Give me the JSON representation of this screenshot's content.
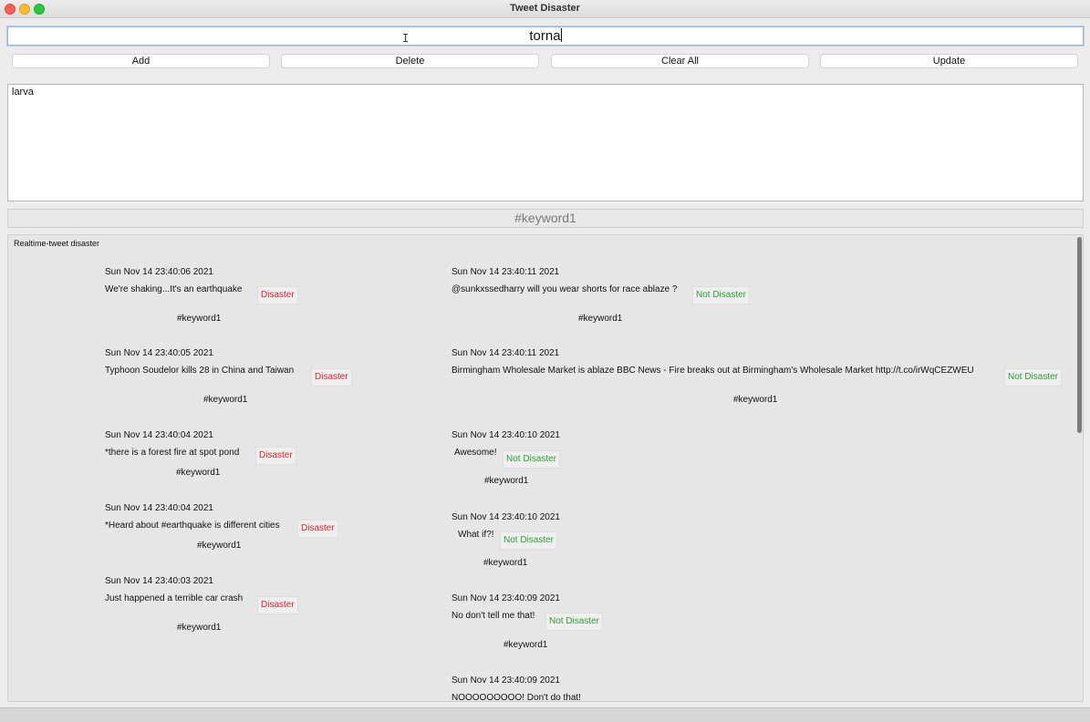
{
  "window": {
    "title": "Tweet Disaster"
  },
  "entry": {
    "value": "torna"
  },
  "buttons": {
    "add": "Add",
    "delete": "Delete",
    "clear_all": "Clear All",
    "update": "Update"
  },
  "keyword_list": [
    "larva"
  ],
  "current_keyword": "#keyword1",
  "frame_title": "Realtime-tweet disaster",
  "colors": {
    "disaster": "#e0242a",
    "not_disaster": "#2e9e30"
  },
  "tweets_left": [
    {
      "date": "Sun Nov 14 23:40:06 2021",
      "text": "We're shaking...It's an earthquake",
      "label": "Disaster",
      "keyword": "#keyword1"
    },
    {
      "date": "Sun Nov 14 23:40:05 2021",
      "text": "Typhoon Soudelor kills 28 in China and Taiwan",
      "label": "Disaster",
      "keyword": "#keyword1"
    },
    {
      "date": "Sun Nov 14 23:40:04 2021",
      "text": "*there is a forest fire at spot pond",
      "label": "Disaster",
      "keyword": "#keyword1"
    },
    {
      "date": "Sun Nov 14 23:40:04 2021",
      "text": "*Heard about #earthquake is different cities",
      "label": "Disaster",
      "keyword": "#keyword1"
    },
    {
      "date": "Sun Nov 14 23:40:03 2021",
      "text": "Just happened a terrible car crash",
      "label": "Disaster",
      "keyword": "#keyword1"
    }
  ],
  "tweets_right": [
    {
      "date": "Sun Nov 14 23:40:11 2021",
      "text": "@sunkxssedharry will you wear shorts for race ablaze ?",
      "label": "Not Disaster",
      "keyword": "#keyword1"
    },
    {
      "date": "Sun Nov 14 23:40:11 2021",
      "text": "Birmingham Wholesale Market is ablaze BBC News - Fire breaks out at Birmingham's Wholesale Market http://t.co/irWqCEZWEU",
      "label": "Not Disaster",
      "keyword": "#keyword1"
    },
    {
      "date": "Sun Nov 14 23:40:10 2021",
      "text": "Awesome!",
      "label": "Not Disaster",
      "keyword": "#keyword1"
    },
    {
      "date": "Sun Nov 14 23:40:10 2021",
      "text": "What if?!",
      "label": "Not Disaster",
      "keyword": "#keyword1"
    },
    {
      "date": "Sun Nov 14 23:40:09 2021",
      "text": "No don't tell me that!",
      "label": "Not Disaster",
      "keyword": "#keyword1"
    },
    {
      "date": "Sun Nov 14 23:40:09 2021",
      "text": "NOOOOOOOOO! Don't do that!",
      "label": "",
      "keyword": ""
    }
  ]
}
